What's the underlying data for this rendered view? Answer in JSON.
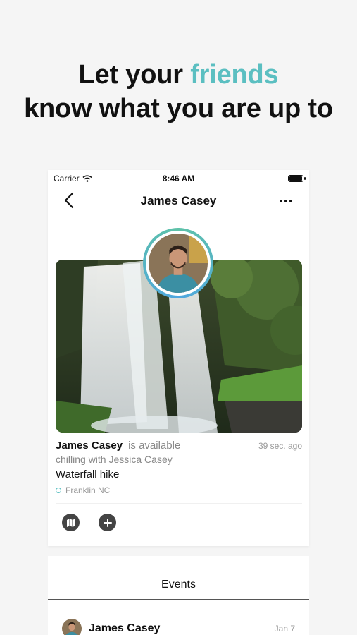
{
  "headline": {
    "line1_prefix": "Let your ",
    "line1_accent": "friends",
    "line2": "know what you are up to"
  },
  "colors": {
    "accent": "#5bbfc1",
    "ring_start": "#5ec2a8",
    "ring_end": "#4fa7e0"
  },
  "status_bar": {
    "carrier": "Carrier",
    "time": "8:46 AM"
  },
  "navbar": {
    "title": "James Casey"
  },
  "post": {
    "name": "James Casey",
    "availability": "is available",
    "time_ago": "39 sec. ago",
    "status": "chilling with Jessica Casey",
    "activity": "Waterfall hike",
    "location": "Franklin NC"
  },
  "actions": [
    {
      "icon": "map-icon"
    },
    {
      "icon": "plus-icon"
    }
  ],
  "events": {
    "title": "Events",
    "items": [
      {
        "name": "James Casey",
        "date": "Jan 7"
      }
    ]
  }
}
